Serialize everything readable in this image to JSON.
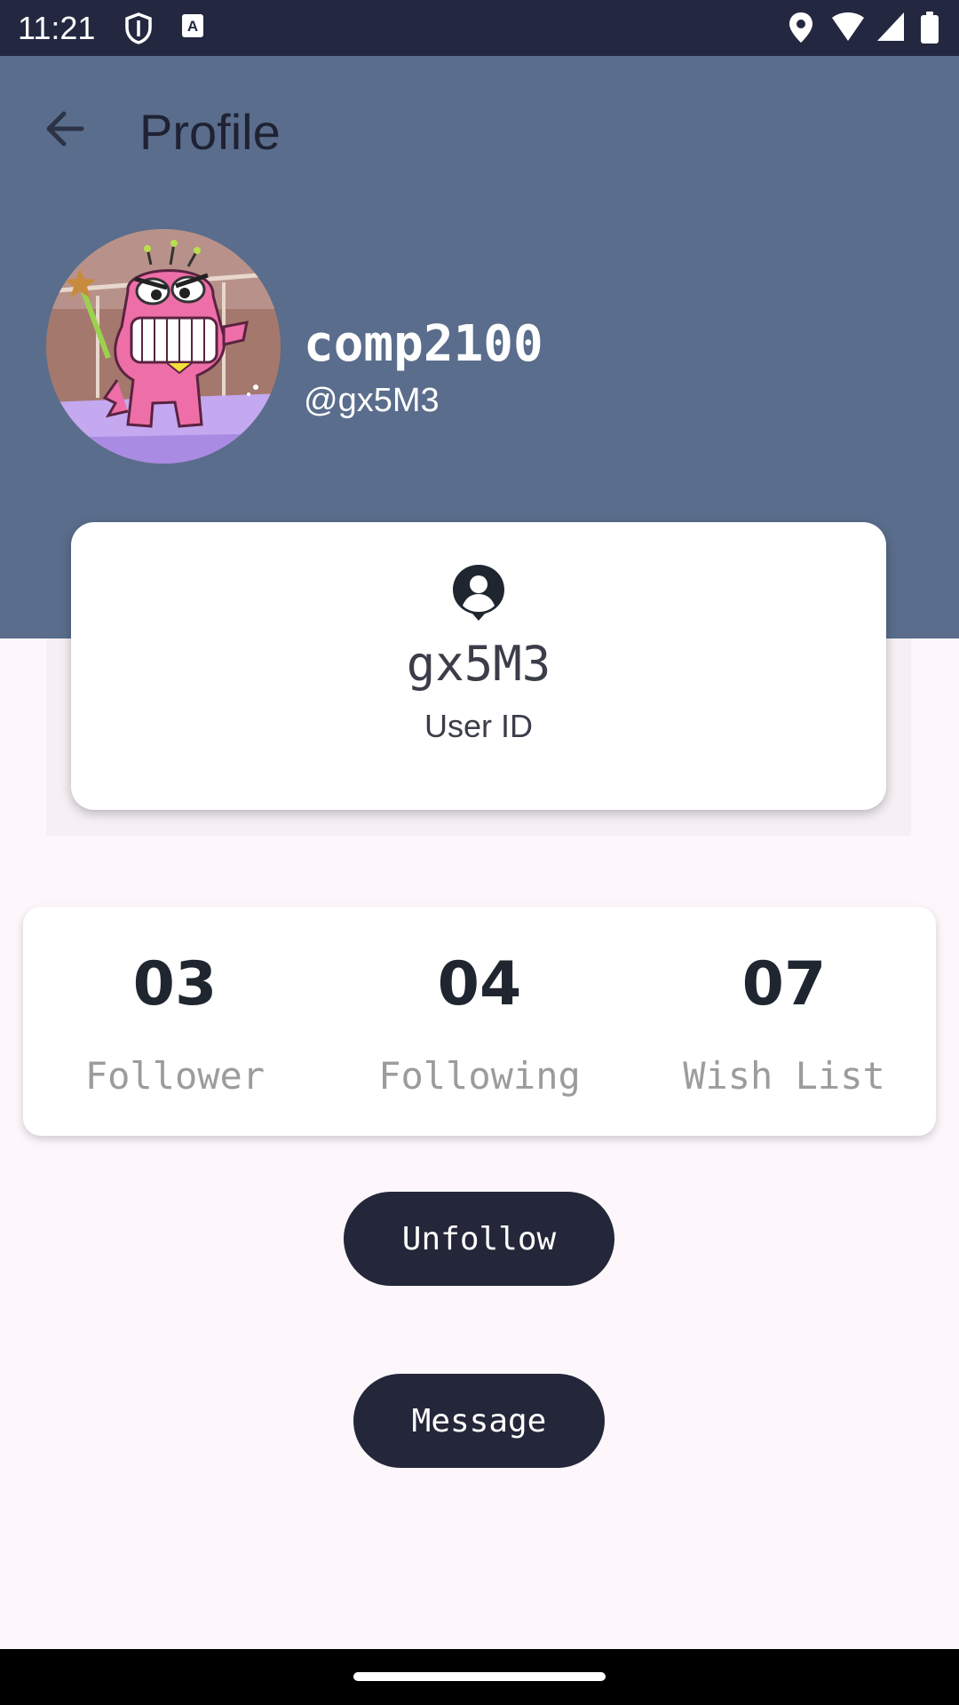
{
  "status_bar": {
    "time": "11:21",
    "left_icons": [
      "shield-icon",
      "a-badge-icon"
    ],
    "right_icons": [
      "location-icon",
      "wifi-icon",
      "signal-icon",
      "battery-icon"
    ]
  },
  "header": {
    "title": "Profile",
    "back_icon": "arrow-left-icon"
  },
  "profile": {
    "name": "comp2100",
    "handle": "@gx5M3",
    "avatar": "cartoon-pink-dinosaur-avatar"
  },
  "user_id_card": {
    "icon": "person-pin-icon",
    "value": "gx5M3",
    "label": "User ID"
  },
  "stats": [
    {
      "value": "03",
      "label": "Follower"
    },
    {
      "value": "04",
      "label": "Following"
    },
    {
      "value": "07",
      "label": "Wish List"
    }
  ],
  "actions": {
    "unfollow_label": "Unfollow",
    "message_label": "Message"
  },
  "colors": {
    "header_bg": "#5a6d8c",
    "status_bar_bg": "#242740",
    "button_bg": "#242739",
    "page_bg": "#fdf7fb"
  }
}
